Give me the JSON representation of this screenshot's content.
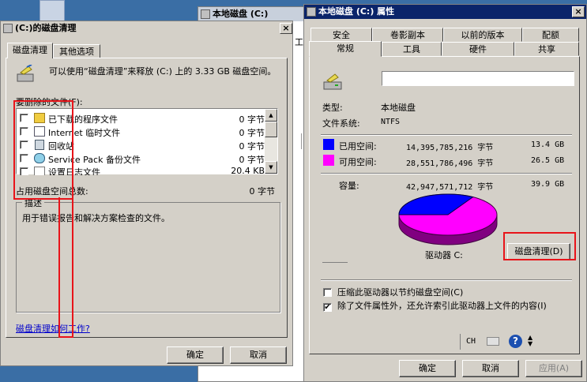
{
  "bg_window": {
    "title": "本地磁盘 (C:)",
    "menu_hint": "工"
  },
  "cleanup": {
    "title": "(C:)的磁盘清理",
    "close": "×",
    "tabs": [
      "磁盘清理",
      "其他选项"
    ],
    "intro": "可以使用“磁盘清理”来释放  (C:) 上的 3.33 GB 磁盘空间。",
    "files_label": "要删除的文件(F):",
    "items": [
      {
        "name": "已下载的程序文件",
        "size": "0 字节",
        "icon": "folder-icon"
      },
      {
        "name": "Internet 临时文件",
        "size": "0 字节",
        "icon": "document-icon"
      },
      {
        "name": "回收站",
        "size": "0 字节",
        "icon": "recycle-bin-icon"
      },
      {
        "name": "Service Pack 备份文件",
        "size": "0 字节",
        "icon": "backup-icon"
      },
      {
        "name": "设置日志文件",
        "size": "20.4 KB",
        "icon": "log-icon"
      }
    ],
    "total_label": "占用磁盘空间总数:",
    "total_value": "0 字节",
    "desc_group": "描述",
    "desc_text": "用于错误报告和解决方案检查的文件。",
    "help_link": "磁盘清理如何工作?",
    "ok": "确定",
    "cancel": "取消"
  },
  "props": {
    "title": "本地磁盘 (C:) 属性",
    "close": "×",
    "tabs_top": [
      "安全",
      "卷影副本",
      "以前的版本",
      "配额"
    ],
    "tabs_bottom": [
      "常规",
      "工具",
      "硬件",
      "共享"
    ],
    "name_value": "",
    "type_label": "类型:",
    "type_value": "本地磁盘",
    "fs_label": "文件系统:",
    "fs_value": "NTFS",
    "used_label": "已用空间:",
    "used_bytes": "14,395,785,216 字节",
    "used_gb": "13.4 GB",
    "free_label": "可用空间:",
    "free_bytes": "28,551,786,496 字节",
    "free_gb": "26.5 GB",
    "cap_label": "容量:",
    "cap_bytes": "42,947,571,712 字节",
    "cap_gb": "39.9 GB",
    "drive_label": "驱动器 C:",
    "cleanup_btn": "磁盘清理(D)",
    "compress_label": "压缩此驱动器以节约磁盘空间(C)",
    "index_label": "除了文件属性外，还允许索引此驱动器上文件的内容(I)",
    "compress_checked": false,
    "index_checked": true,
    "tray_lang": "CH",
    "ok": "确定",
    "cancel": "取消",
    "apply": "应用(A)",
    "used_fraction": 0.335,
    "colors": {
      "used": "#0000ff",
      "free": "#ff00ff"
    }
  }
}
